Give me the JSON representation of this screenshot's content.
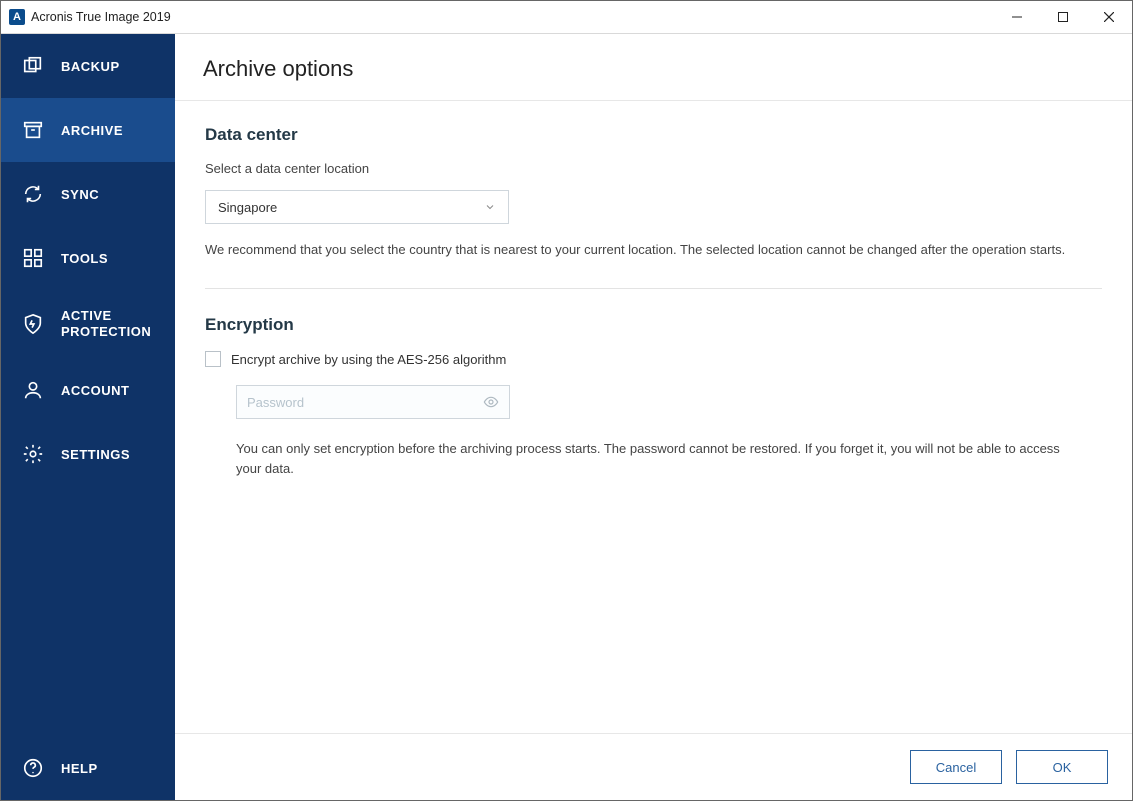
{
  "titlebar": {
    "icon_letter": "A",
    "title": "Acronis True Image 2019"
  },
  "sidebar": {
    "items": [
      {
        "label": "BACKUP"
      },
      {
        "label": "ARCHIVE"
      },
      {
        "label": "SYNC"
      },
      {
        "label": "TOOLS"
      },
      {
        "label": "ACTIVE PROTECTION"
      },
      {
        "label": "ACCOUNT"
      },
      {
        "label": "SETTINGS"
      },
      {
        "label": "HELP"
      }
    ]
  },
  "main": {
    "header_title": "Archive options",
    "data_center": {
      "heading": "Data center",
      "label": "Select a data center location",
      "selected": "Singapore",
      "info": "We recommend that you select the country that is nearest to your current location. The selected location cannot be changed after the operation starts."
    },
    "encryption": {
      "heading": "Encryption",
      "checkbox_label": "Encrypt archive by using the AES-256 algorithm",
      "password_placeholder": "Password",
      "note": "You can only set encryption before the archiving process starts. The password cannot be restored. If you forget it, you will not be able to access your data."
    }
  },
  "footer": {
    "cancel": "Cancel",
    "ok": "OK"
  }
}
